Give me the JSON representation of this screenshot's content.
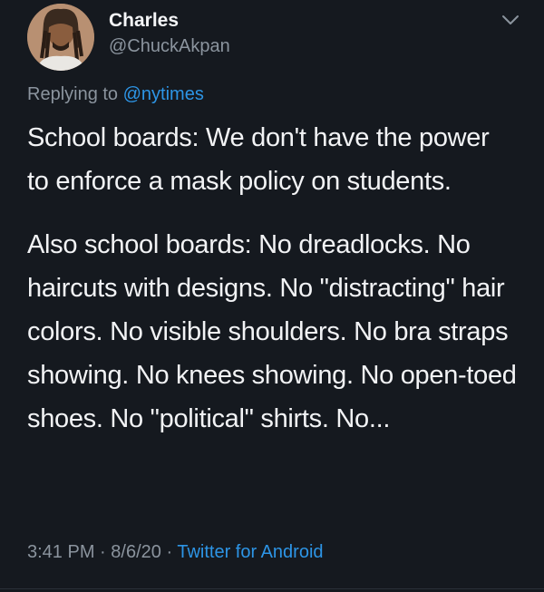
{
  "tweet": {
    "author_name": "Charles",
    "author_handle": "@ChuckAkpan",
    "replying_prefix": "Replying to",
    "replying_to": "@nytimes",
    "paragraphs": [
      "School boards: We don't have the power to enforce a mask policy on students.",
      "Also school boards: No dreadlocks. No haircuts with designs. No \"distracting\" hair colors. No visible shoulders. No bra straps showing. No knees showing. No open-toed shoes. No \"political\" shirts. No..."
    ],
    "time": "3:41 PM",
    "separator": "·",
    "date": "8/6/20",
    "source": "Twitter for Android"
  },
  "icons": {
    "avatar": "profile-photo",
    "caret": "chevron-down-icon"
  },
  "colors": {
    "background": "#15191f",
    "text": "#f2f3f5",
    "muted": "#8b949e",
    "link": "#2d95e6"
  }
}
